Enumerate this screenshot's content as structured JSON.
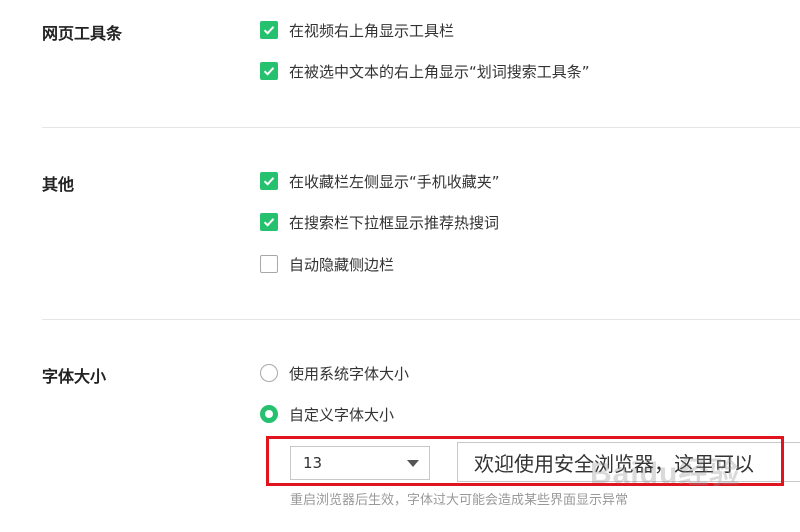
{
  "sections": {
    "web_toolbar": {
      "title": "网页工具条",
      "options": [
        {
          "label": "在视频右上角显示工具栏",
          "checked": true
        },
        {
          "label": "在被选中文本的右上角显示“划词搜索工具条”",
          "checked": true
        }
      ]
    },
    "other": {
      "title": "其他",
      "options": [
        {
          "label": "在收藏栏左侧显示“手机收藏夹”",
          "checked": true
        },
        {
          "label": "在搜索栏下拉框显示推荐热搜词",
          "checked": true
        },
        {
          "label": "自动隐藏侧边栏",
          "checked": false
        }
      ]
    },
    "font_size": {
      "title": "字体大小",
      "options": [
        {
          "label": "使用系统字体大小",
          "selected": false
        },
        {
          "label": "自定义字体大小",
          "selected": true
        }
      ],
      "selected_size": "13",
      "preview_text": "欢迎使用安全浏览器，这里可以",
      "hint": "重启浏览器后生效，字体过大可能会造成某些界面显示异常"
    }
  },
  "watermark": "Baidu经验",
  "colors": {
    "accent": "#25c16f",
    "highlight": "#e0141e"
  }
}
